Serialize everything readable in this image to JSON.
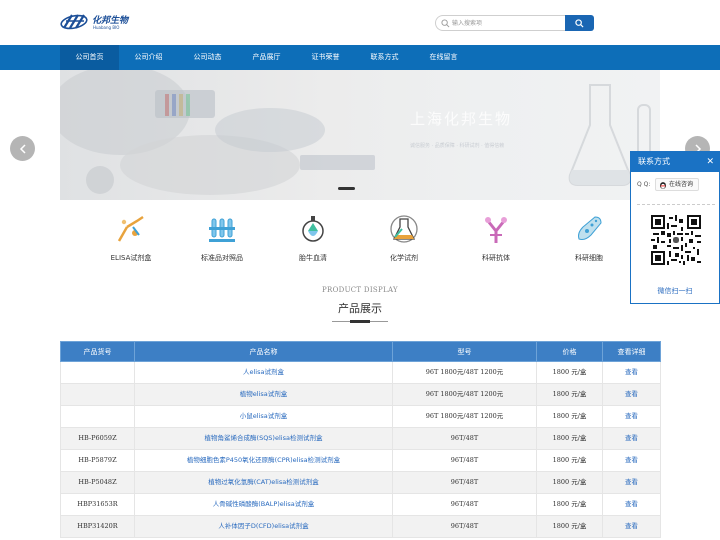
{
  "brand": {
    "logo_text": "化邦生物",
    "logo_sub": "Huabang BIO"
  },
  "search": {
    "placeholder": "输入搜索项"
  },
  "nav": {
    "items": [
      {
        "label": "公司首页"
      },
      {
        "label": "公司介绍"
      },
      {
        "label": "公司动态"
      },
      {
        "label": "产品展厅"
      },
      {
        "label": "证书荣誉"
      },
      {
        "label": "联系方式"
      },
      {
        "label": "在线留言"
      }
    ],
    "active_index": 0
  },
  "banner": {
    "title": "上海化邦生物",
    "subtitle": "诚信服务 · 品质保障 · 科研试剂 · 值得信赖"
  },
  "categories": [
    {
      "label": "ELISA试剂盒",
      "icon": "elisa-icon"
    },
    {
      "label": "标准品对照品",
      "icon": "test-tube-rack-icon"
    },
    {
      "label": "胎牛血清",
      "icon": "flask-icon"
    },
    {
      "label": "化学试剂",
      "icon": "beaker-icon"
    },
    {
      "label": "科研抗体",
      "icon": "antibody-icon"
    },
    {
      "label": "科研细胞",
      "icon": "cell-icon"
    }
  ],
  "section": {
    "en": "PRODUCT DISPLAY",
    "cn": "产品展示"
  },
  "table": {
    "headers": [
      "产品货号",
      "产品名称",
      "型号",
      "价格",
      "查看详细"
    ],
    "rows": [
      {
        "no": "",
        "name": "人elisa试剂盒",
        "spec": "96T 1800元/48T 1200元",
        "price": "1800 元/盒",
        "view": "查看"
      },
      {
        "no": "",
        "name": "植物elisa试剂盒",
        "spec": "96T 1800元/48T 1200元",
        "price": "1800 元/盒",
        "view": "查看"
      },
      {
        "no": "",
        "name": "小鼠elisa试剂盒",
        "spec": "96T 1800元/48T 1200元",
        "price": "1800 元/盒",
        "view": "查看"
      },
      {
        "no": "HB-P6059Z",
        "name": "植物角鲨烯合成酶(SQS)elisa检测试剂盒",
        "spec": "96T/48T",
        "price": "1800 元/盒",
        "view": "查看"
      },
      {
        "no": "HB-P5879Z",
        "name": "植物细胞色素P450氧化还原酶(CPR)elisa检测试剂盒",
        "spec": "96T/48T",
        "price": "1800 元/盒",
        "view": "查看"
      },
      {
        "no": "HB-P5048Z",
        "name": "植物过氧化氢酶(CAT)elisa检测试剂盒",
        "spec": "96T/48T",
        "price": "1800 元/盒",
        "view": "查看"
      },
      {
        "no": "HBP31653R",
        "name": "人骨碱性磷酸酶(BALP)elisa试剂盒",
        "spec": "96T/48T",
        "price": "1800 元/盒",
        "view": "查看"
      },
      {
        "no": "HBP31420R",
        "name": "人补体因子D(CFD)elisa试剂盒",
        "spec": "96T/48T",
        "price": "1800 元/盒",
        "view": "查看"
      }
    ]
  },
  "contact": {
    "title": "联系方式",
    "close": "✕",
    "qq_label": "Q Q:",
    "chat_label": "在线咨询",
    "wechat_label": "微信扫一扫"
  },
  "colors": {
    "primary": "#0d6eb8",
    "table_header": "#3d7fc5",
    "link": "#2a6bbf"
  }
}
